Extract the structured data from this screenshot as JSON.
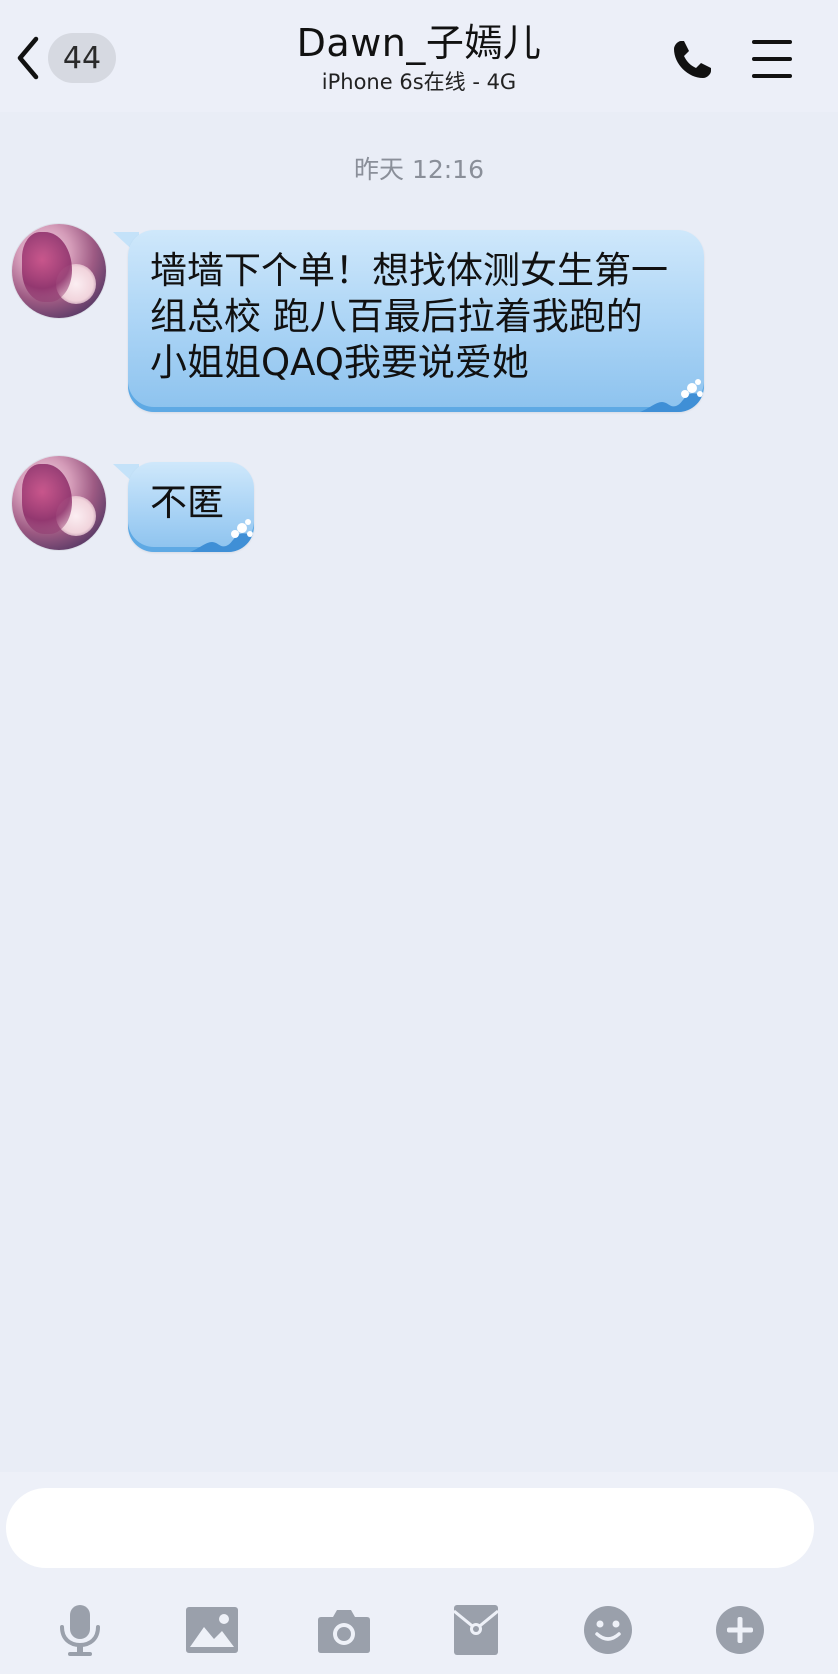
{
  "header": {
    "back_badge": "44",
    "title": "Dawn_子嫣儿",
    "subtitle": "iPhone 6s在线 - 4G"
  },
  "conversation": {
    "timestamp": "昨天 12:16",
    "messages": [
      {
        "sender": "contact",
        "text": "墙墙下个单！想找体测女生第一组总校 跑八百最后拉着我跑的小姐姐QAQ我要说爱她"
      },
      {
        "sender": "contact",
        "text": "不匿"
      }
    ]
  },
  "input": {
    "placeholder": "",
    "value": ""
  },
  "toolbar": {
    "icons": [
      "microphone-icon",
      "picture-icon",
      "camera-icon",
      "red-packet-icon",
      "emoji-icon",
      "plus-icon"
    ]
  },
  "colors": {
    "background": "#e9edf6",
    "bubble": "#a9d3f5",
    "icon_gray": "#9aa0ab"
  }
}
